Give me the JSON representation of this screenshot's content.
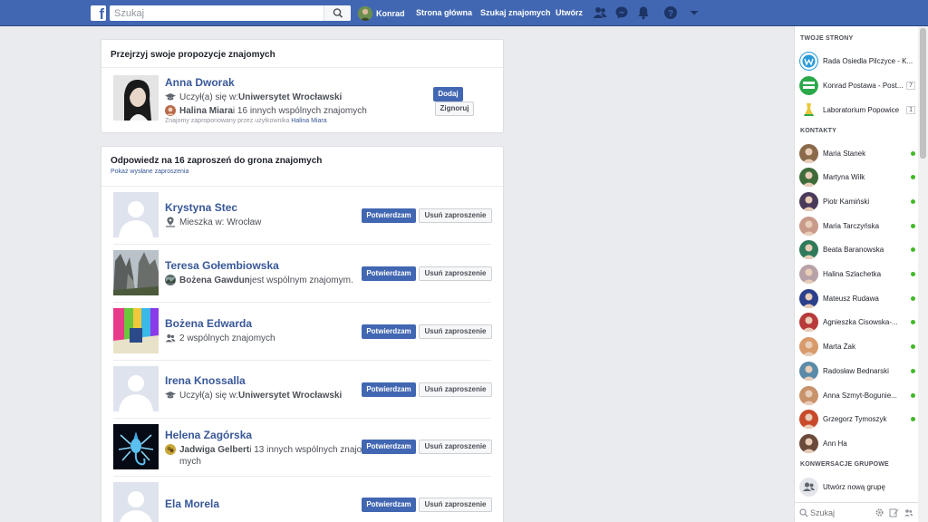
{
  "topbar": {
    "logo": "f",
    "search_placeholder": "Szukaj",
    "user_name": "Konrad",
    "nav_home": "Strona główna",
    "nav_find_friends": "Szukaj znajomych",
    "nav_create": "Utwórz",
    "icons": [
      "friend-requests-icon",
      "messenger-icon",
      "notifications-icon",
      "help-icon",
      "menu-caret-icon"
    ]
  },
  "suggestions": {
    "title": "Przejrzyj swoje propozycje znajomych",
    "person": {
      "name": "Anna Dworak",
      "studied_prefix": "Uczył(a) się w: ",
      "school": "Uniwersytet Wrocławski",
      "mutual_name": "Halina Miara",
      "mutual_rest": " i 16 innych wspólnych znajomych",
      "suggested_by_prefix": "Znajomy zaproponowany przez użytkownika ",
      "suggested_by": "Halina Miara",
      "add_label": "Dodaj",
      "ignore_label": "Zignoruj"
    }
  },
  "requests": {
    "title": "Odpowiedz na 16 zaproszeń do grona znajomych",
    "view_sent": "Pokaż wysłane zaproszenia",
    "confirm_label": "Potwierdzam",
    "delete_label": "Usuń zaproszenie",
    "items": [
      {
        "name": "Krystyna Stec",
        "icon": "location-icon",
        "line_plain": "Mieszka w: Wrocław",
        "line_bold": "",
        "line_rest": ""
      },
      {
        "name": "Teresa Gołembiowska",
        "icon": "mutual-avatar-icon",
        "line_plain": "",
        "line_bold": "Bożena Gawdun",
        "line_rest": " jest wspólnym znajomym."
      },
      {
        "name": "Bożena Edwarda",
        "icon": "friends-icon",
        "line_plain": "2 wspólnych znajomych",
        "line_bold": "",
        "line_rest": ""
      },
      {
        "name": "Irena Knossalla",
        "icon": "graduation-cap-icon",
        "line_plain": "Uczył(a) się w: ",
        "line_bold": "Uniwersytet Wrocławski",
        "line_rest": ""
      },
      {
        "name": "Helena Zagórska",
        "icon": "mutual-avatar-icon",
        "line_plain": "",
        "line_bold": "Jadwiga Gelbert",
        "line_rest": " i 13 innych wspólnych znajo",
        "line_rest2": "mych"
      },
      {
        "name": "Ela Morela",
        "icon": "",
        "line_plain": "",
        "line_bold": "",
        "line_rest": ""
      }
    ]
  },
  "sidebar": {
    "pages_header": "TWOJE STRONY",
    "pages": [
      {
        "name": "Rada Osiedla Pilczyce - K...",
        "badge": ""
      },
      {
        "name": "Konrad Postawa - Post...",
        "badge": "7"
      },
      {
        "name": "Laboratorium Popowice",
        "badge": "1"
      }
    ],
    "contacts_header": "KONTAKTY",
    "contacts": [
      {
        "name": "Maria Stanek",
        "color": "#8a6a4a"
      },
      {
        "name": "Martyna Wilk",
        "color": "#3f6b3a"
      },
      {
        "name": "Piotr Kamiński",
        "color": "#4a3a5a"
      },
      {
        "name": "Maria Tarczyńska",
        "color": "#c89a8a"
      },
      {
        "name": "Beata Baranowska",
        "color": "#2f7a5a"
      },
      {
        "name": "Halina Szlachetka",
        "color": "#b8a2a8"
      },
      {
        "name": "Mateusz Rudawa",
        "color": "#2b3f8a"
      },
      {
        "name": "Agnieszka Cisowska-...",
        "color": "#b83a3a"
      },
      {
        "name": "Marta Żak",
        "color": "#d89a6a"
      },
      {
        "name": "Radosław Bednarski",
        "color": "#5a8aa8"
      },
      {
        "name": "Anna Szmyt-Bogunie...",
        "color": "#c8926a"
      },
      {
        "name": "Grzegorz Tymoszyk",
        "color": "#c84a2a"
      },
      {
        "name": "Ann Ha",
        "color": "#6a4a3a"
      }
    ],
    "groups_header": "KONWERSACJE GRUPOWE",
    "new_group": "Utwórz nową grupę",
    "chat_search_placeholder": "Szukaj"
  }
}
